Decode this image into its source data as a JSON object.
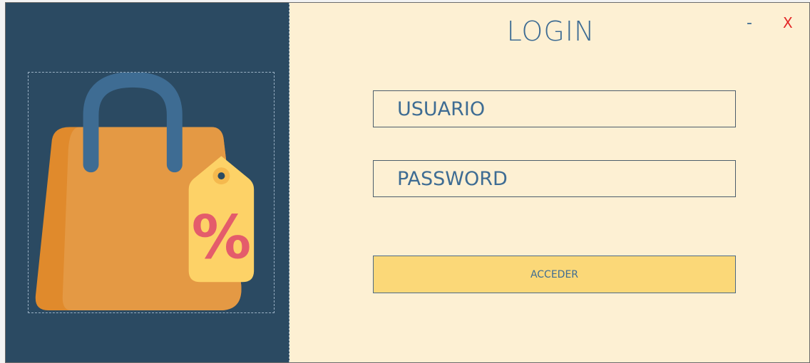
{
  "window": {
    "minimize_label": "-",
    "close_label": "X"
  },
  "login": {
    "title": "LOGIN",
    "username_placeholder": "USUARIO",
    "password_placeholder": "PASSWORD",
    "submit_label": "ACCEDER"
  },
  "logo": {
    "icon": "shopping-bag-icon",
    "tag_text": "%"
  },
  "colors": {
    "left_panel_bg": "#2b4a62",
    "right_panel_bg": "#fdf0d3",
    "accent_text": "#3e6c93",
    "button_bg": "#fbd878",
    "close_red": "#e32828",
    "bag_orange": "#e49944",
    "tag_yellow": "#fdd267",
    "percent_pink": "#e45c6b"
  }
}
